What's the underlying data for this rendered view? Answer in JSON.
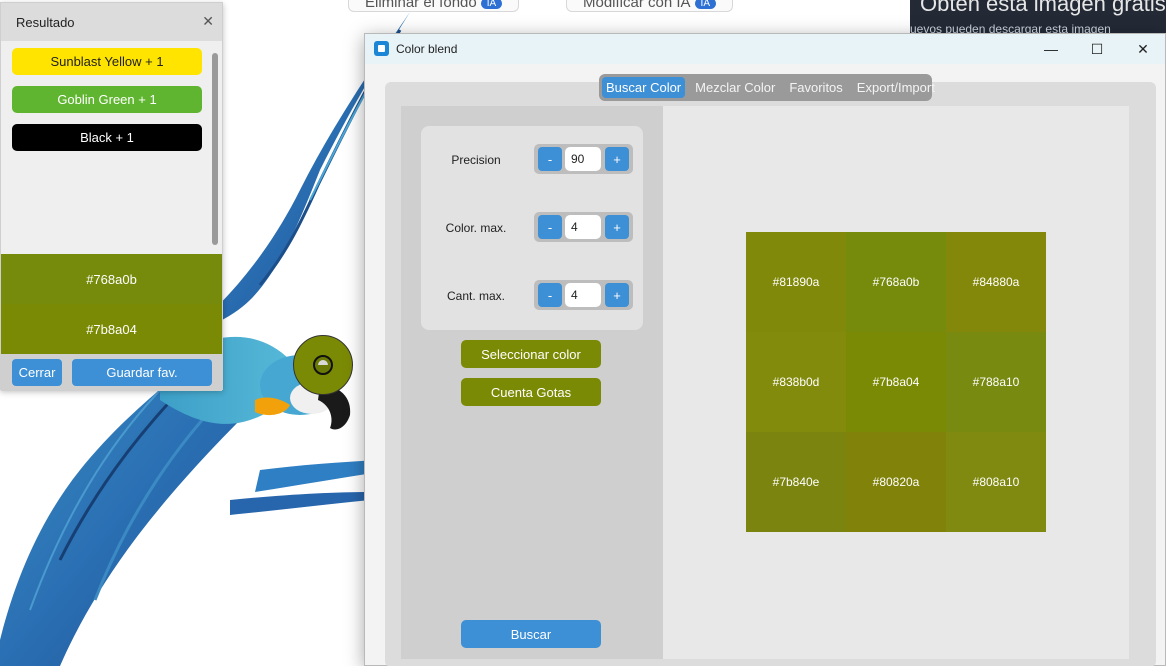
{
  "background": {
    "buttons": [
      {
        "label": "Eliminar el fondo",
        "badge": "IA"
      },
      {
        "label": "Modificar con IA",
        "badge": "IA"
      }
    ],
    "promo_title": "Obtén esta imagen gratis",
    "promo_sub": "uevos pueden descargar esta imagen"
  },
  "result_panel": {
    "title": "Resultado",
    "close_icon": "close-icon",
    "items": [
      {
        "label": "Sunblast Yellow + 1",
        "bg": "#ffe400",
        "fg": "#222222"
      },
      {
        "label": "Goblin Green + 1",
        "bg": "#5fb52f",
        "fg": "#ffffff"
      },
      {
        "label": "Black + 1",
        "bg": "#000000",
        "fg": "#ffffff"
      }
    ],
    "swatches": [
      {
        "hex": "#768a0b"
      },
      {
        "hex": "#7b8a04"
      }
    ],
    "close_button": "Cerrar",
    "save_button": "Guardar fav."
  },
  "window": {
    "title": "Color blend",
    "controls": {
      "minimize": "—",
      "maximize": "☐",
      "close": "✕"
    },
    "tabs": [
      {
        "label": "Buscar Color",
        "active": true
      },
      {
        "label": "Mezclar Color",
        "active": false
      },
      {
        "label": "Favoritos",
        "active": false
      },
      {
        "label": "Export/Import",
        "active": false
      }
    ],
    "params": [
      {
        "label": "Precision",
        "value": "90"
      },
      {
        "label": "Color. max.",
        "value": "4"
      },
      {
        "label": "Cant. max.",
        "value": "4"
      }
    ],
    "stepper": {
      "minus": "-",
      "plus": "+"
    },
    "select_color_button": "Seleccionar color",
    "eyedropper_button": "Cuenta Gotas",
    "search_button": "Buscar",
    "grid": [
      "#81890a",
      "#768a0b",
      "#84880a",
      "#838b0d",
      "#7b8a04",
      "#788a10",
      "#7b840e",
      "#80820a",
      "#808a10"
    ]
  },
  "colors": {
    "accent_blue": "#3d8fd6",
    "olive": "#7b8a04"
  }
}
